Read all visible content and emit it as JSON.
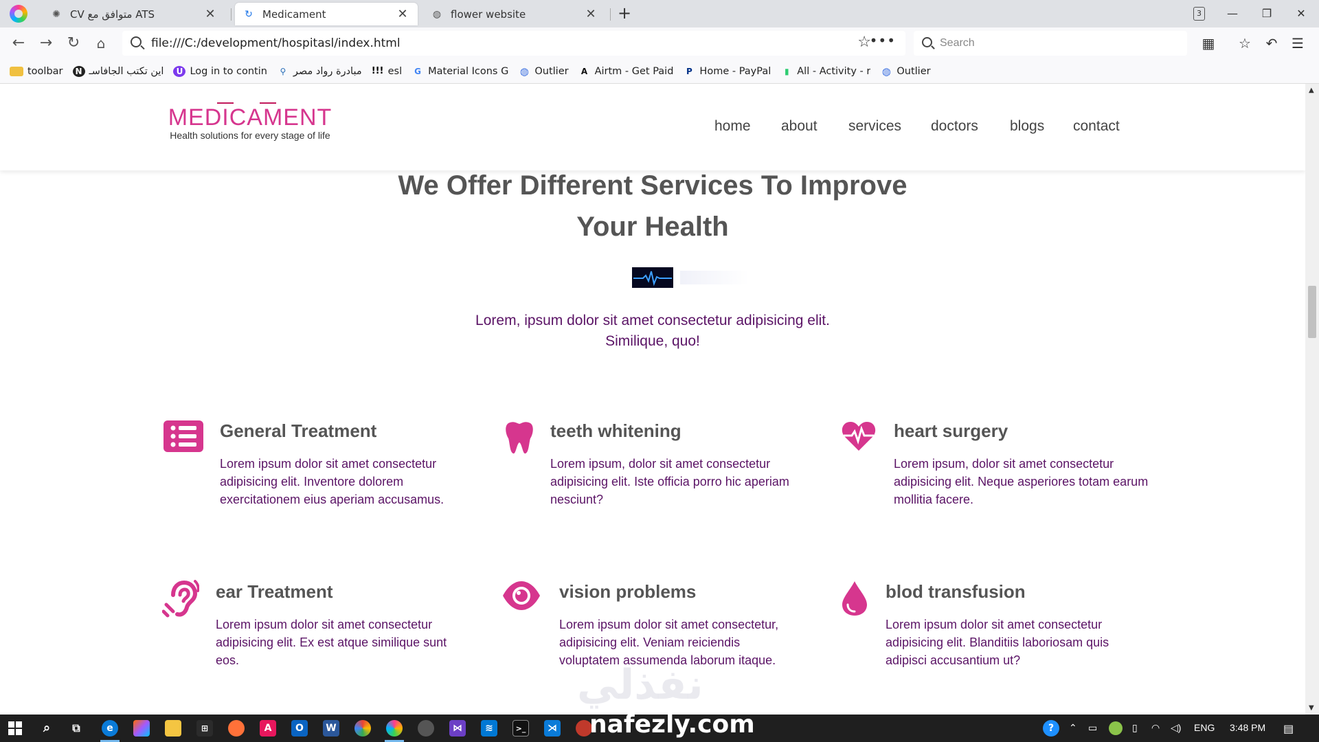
{
  "browser": {
    "tabs": [
      {
        "title": "CV متوافق مع ATS",
        "icon": "openai-icon",
        "active": false
      },
      {
        "title": "Medicament",
        "icon": "loading-spinner-icon",
        "active": true
      },
      {
        "title": "flower website",
        "icon": "globe-icon",
        "active": false
      }
    ],
    "tab_count": "3",
    "url": "file:///C:/development/hospitasl/index.html",
    "search_placeholder": "Search",
    "bookmarks": [
      {
        "label": "toolbar",
        "icon": "folder-icon"
      },
      {
        "label": "اين تكتب الجافاسـ",
        "icon": "n-logo-icon",
        "glyph": "N"
      },
      {
        "label": "Log in to contin",
        "icon": "user-circle-icon",
        "glyph": "U"
      },
      {
        "label": "مبادرة رواد مصر",
        "icon": "initiative-logo-icon",
        "glyph": "⚲"
      },
      {
        "label": "esl",
        "icon": "exclamation-icon",
        "glyph": "!!!"
      },
      {
        "label": "Material Icons G",
        "icon": "google-icon",
        "glyph": "G"
      },
      {
        "label": "Outlier",
        "icon": "outlier-icon",
        "glyph": "◍"
      },
      {
        "label": "Airtm - Get Paid",
        "icon": "airtm-icon",
        "glyph": "A"
      },
      {
        "label": "Home - PayPal",
        "icon": "paypal-icon",
        "glyph": "P"
      },
      {
        "label": "All - Activity - r",
        "icon": "activity-icon",
        "glyph": "▮"
      },
      {
        "label": "Outlier",
        "icon": "outlier-icon",
        "glyph": "◍"
      }
    ]
  },
  "site": {
    "logo_name": "MEDICAMENT",
    "logo_tagline": "Health solutions for every stage of life",
    "menu": [
      "home",
      "about",
      "services",
      "doctors",
      "blogs",
      "contact"
    ],
    "section_title": "We Offer Different Services To Improve Your Health",
    "section_subtitle": "Lorem, ipsum dolor sit amet consectetur adipisicing elit. Similique, quo!",
    "services": [
      {
        "icon": "list-icon",
        "title": "General Treatment",
        "desc": "Lorem ipsum dolor sit amet consectetur adipisicing elit. Inventore dolorem exercitationem eius aperiam accusamus."
      },
      {
        "icon": "tooth-icon",
        "title": "teeth whitening",
        "desc": "Lorem ipsum, dolor sit amet consectetur adipisicing elit. Iste officia porro hic aperiam nesciunt?"
      },
      {
        "icon": "heart-pulse-icon",
        "title": "heart surgery",
        "desc": "Lorem ipsum, dolor sit amet consectetur adipisicing elit. Neque asperiores totam earum mollitia facere."
      },
      {
        "icon": "ear-icon",
        "title": "ear Treatment",
        "desc": "Lorem ipsum dolor sit amet consectetur adipisicing elit. Ex est atque similique sunt eos."
      },
      {
        "icon": "eye-icon",
        "title": "vision problems",
        "desc": "Lorem ipsum dolor sit amet consectetur, adipisicing elit. Veniam reiciendis voluptatem assumenda laborum itaque."
      },
      {
        "icon": "blood-drop-icon",
        "title": "blod transfusion",
        "desc": "Lorem ipsum dolor sit amet consectetur adipisicing elit. Blanditiis laboriosam quis adipisci accusantium ut?"
      }
    ],
    "accent_color": "#d6368e",
    "text_color": "#5b1466"
  },
  "watermark": {
    "arabic": "نفذلي",
    "latin": "nafezly.com"
  },
  "taskbar": {
    "language": "ENG",
    "time": "3:48 PM"
  }
}
